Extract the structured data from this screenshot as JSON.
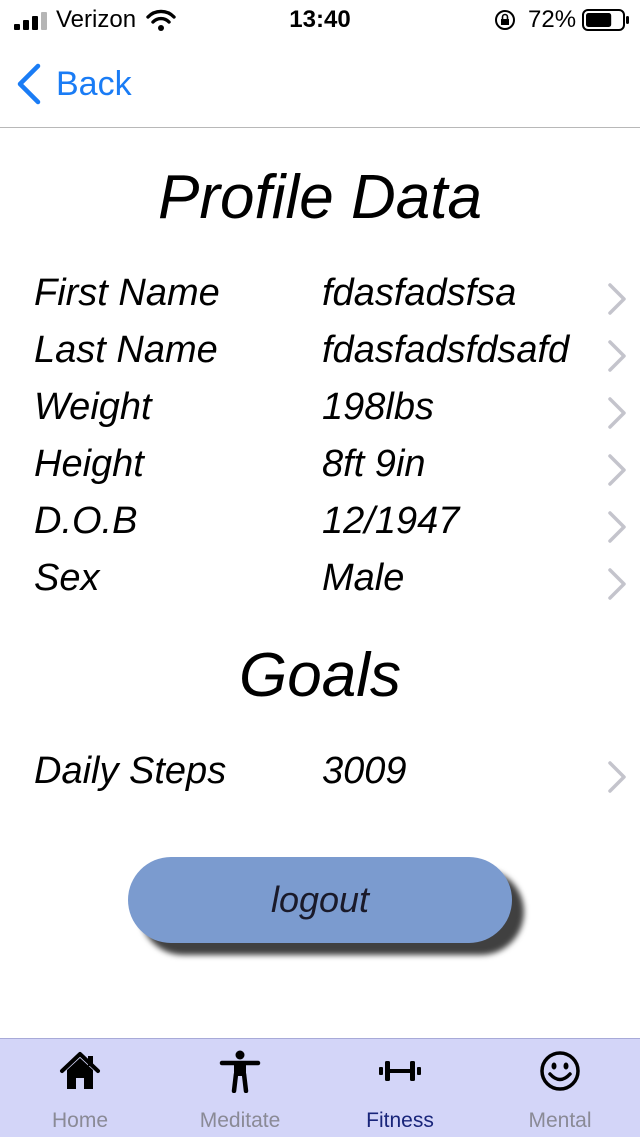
{
  "status_bar": {
    "carrier": "Verizon",
    "time": "13:40",
    "battery": "72%",
    "battery_level": 0.72
  },
  "nav": {
    "back_label": "Back"
  },
  "profile": {
    "title": "Profile Data",
    "rows": [
      {
        "label": "First Name",
        "value": "fdasfadsfsa"
      },
      {
        "label": "Last Name",
        "value": "fdasfadsfdsafd"
      },
      {
        "label": "Weight",
        "value": "198lbs"
      },
      {
        "label": "Height",
        "value": "8ft 9in"
      },
      {
        "label": "D.O.B",
        "value": "12/1947"
      },
      {
        "label": "Sex",
        "value": "Male"
      }
    ]
  },
  "goals": {
    "title": "Goals",
    "rows": [
      {
        "label": "Daily Steps",
        "value": "3009"
      }
    ]
  },
  "logout_label": "logout",
  "tabs": [
    {
      "label": "Home",
      "icon": "home-icon",
      "active": false
    },
    {
      "label": "Meditate",
      "icon": "person-icon",
      "active": false
    },
    {
      "label": "Fitness",
      "icon": "dumbbell-icon",
      "active": true
    },
    {
      "label": "Mental",
      "icon": "smiley-icon",
      "active": false
    }
  ],
  "colors": {
    "accent": "#1a7cf5",
    "button": "#7b9bcf",
    "tab_bar": "#d3d5f8",
    "tab_active": "#18257a",
    "tab_inactive": "#8a8a96"
  }
}
